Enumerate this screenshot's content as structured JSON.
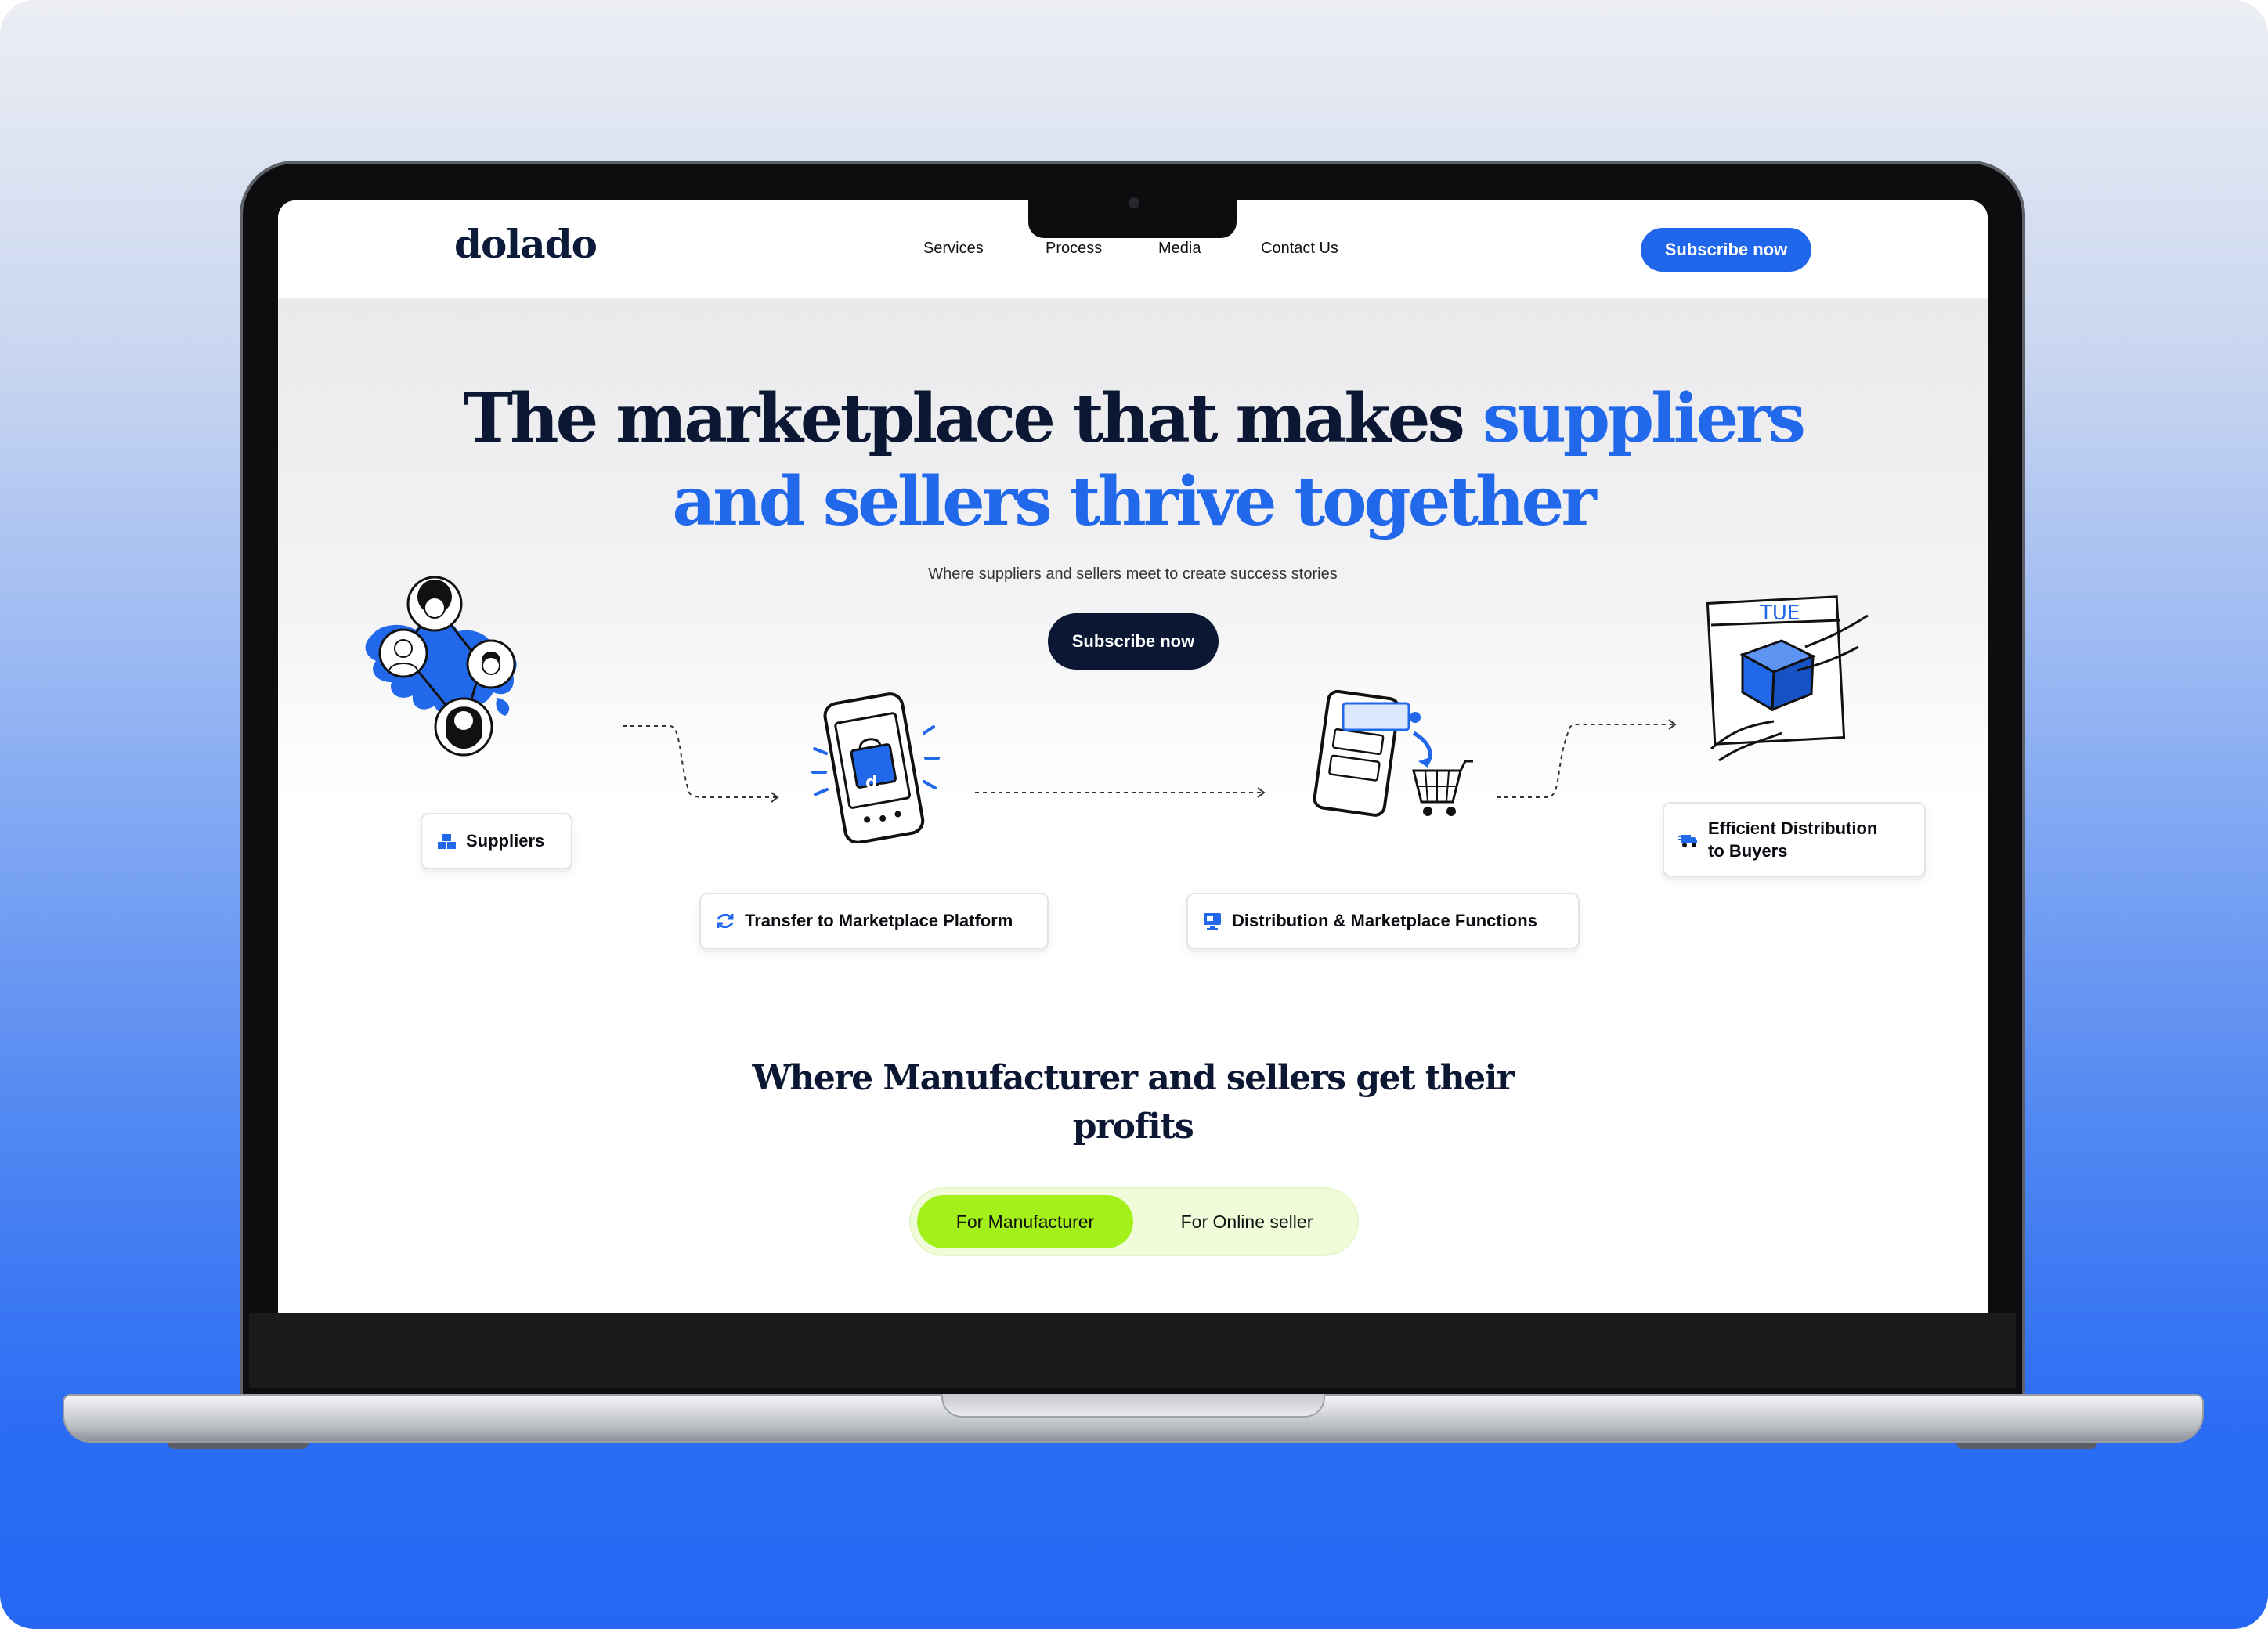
{
  "brand": {
    "logo": "dolado"
  },
  "nav": {
    "links": [
      "Services",
      "Process",
      "Media",
      "Contact Us"
    ],
    "cta": "Subscribe now"
  },
  "hero": {
    "title_dark": "The marketplace that makes",
    "title_blue_1": "suppliers",
    "title_blue_2": "and sellers thrive together",
    "subtitle": "Where suppliers and sellers meet to create success stories",
    "cta": "Subscribe now"
  },
  "flow": {
    "steps": [
      {
        "label": "Suppliers",
        "icon": "boxes-icon"
      },
      {
        "label": "Transfer to Marketplace Platform",
        "icon": "sync-arrows-icon"
      },
      {
        "label": "Distribution & Marketplace Functions",
        "icon": "monitor-icon"
      },
      {
        "label_line1": "Efficient Distribution",
        "label_line2": "to Buyers",
        "icon": "delivery-truck-icon"
      }
    ],
    "calendar_day": "TUE",
    "app_badge": "d."
  },
  "profits": {
    "title_line1": "Where Manufacturer and sellers get their",
    "title_line2": "profits",
    "tabs": [
      "For Manufacturer",
      "For Online seller"
    ],
    "active_tab": "For Manufacturer"
  },
  "colors": {
    "brand_blue": "#2268ea",
    "navy": "#0b1733",
    "lime": "#a3f01a",
    "background_blue": "#2567f4"
  }
}
